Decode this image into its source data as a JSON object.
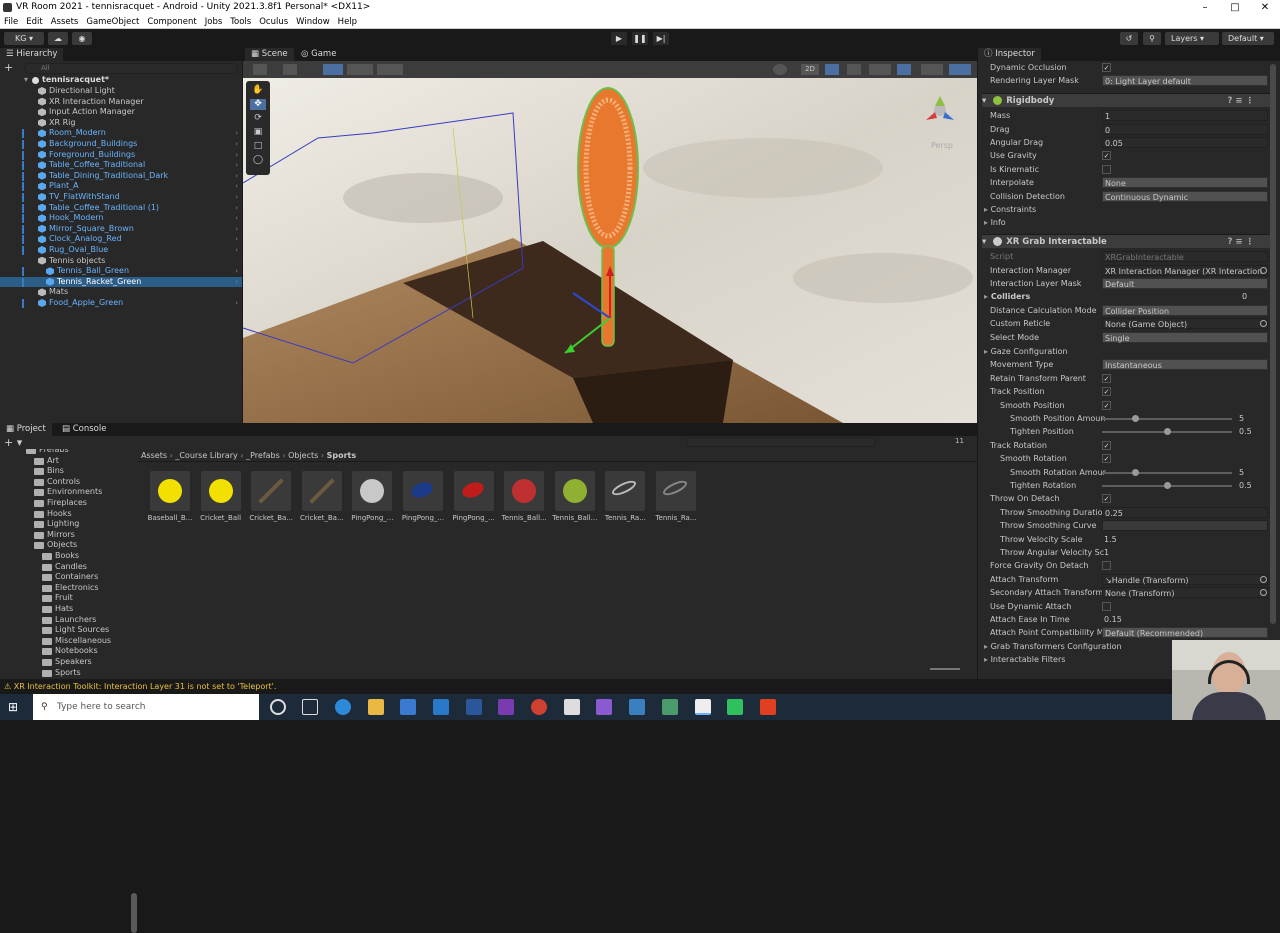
{
  "window": {
    "title": "VR Room 2021 - tennisracquet - Android - Unity 2021.3.8f1 Personal* <DX11>"
  },
  "menu": [
    "File",
    "Edit",
    "Assets",
    "GameObject",
    "Component",
    "Jobs",
    "Tools",
    "Oculus",
    "Window",
    "Help"
  ],
  "toolbar": {
    "account": "KG ▾",
    "layers": "Layers",
    "layout": "Default"
  },
  "hierarchy": {
    "tab": "Hierarchy",
    "search_placeholder": "All",
    "scene": "tennisracquet*",
    "items": [
      {
        "label": "Directional Light",
        "indent": 1,
        "prefab": false
      },
      {
        "label": "XR Interaction Manager",
        "indent": 1,
        "prefab": false
      },
      {
        "label": "Input Action Manager",
        "indent": 1,
        "prefab": false
      },
      {
        "label": "XR Rig",
        "indent": 1,
        "prefab": false
      },
      {
        "label": "Room_Modern",
        "indent": 1,
        "prefab": true
      },
      {
        "label": "Background_Buildings",
        "indent": 1,
        "prefab": true
      },
      {
        "label": "Foreground_Buildings",
        "indent": 1,
        "prefab": true
      },
      {
        "label": "Table_Coffee_Traditional",
        "indent": 1,
        "prefab": true
      },
      {
        "label": "Table_Dining_Traditional_Dark",
        "indent": 1,
        "prefab": true
      },
      {
        "label": "Plant_A",
        "indent": 1,
        "prefab": true
      },
      {
        "label": "TV_FlatWithStand",
        "indent": 1,
        "prefab": true
      },
      {
        "label": "Table_Coffee_Traditional (1)",
        "indent": 1,
        "prefab": true
      },
      {
        "label": "Hook_Modern",
        "indent": 1,
        "prefab": true
      },
      {
        "label": "Mirror_Square_Brown",
        "indent": 1,
        "prefab": true
      },
      {
        "label": "Clock_Analog_Red",
        "indent": 1,
        "prefab": true
      },
      {
        "label": "Rug_Oval_Blue",
        "indent": 1,
        "prefab": true
      },
      {
        "label": "Tennis objects",
        "indent": 1,
        "prefab": false
      },
      {
        "label": "Tennis_Ball_Green",
        "indent": 2,
        "prefab": true
      },
      {
        "label": "Tennis_Racket_Green",
        "indent": 2,
        "prefab": true,
        "selected": true
      },
      {
        "label": "Mats",
        "indent": 1,
        "prefab": false
      },
      {
        "label": "Food_Apple_Green",
        "indent": 1,
        "prefab": true
      }
    ]
  },
  "scene": {
    "tab_scene": "Scene",
    "tab_game": "Game",
    "mode2d": "2D",
    "persp": "Persp"
  },
  "project": {
    "tab_project": "Project",
    "tab_console": "Console",
    "breadcrumb": [
      "Assets",
      "_Course Library",
      "_Prefabs",
      "Objects",
      "Sports"
    ],
    "folders": [
      {
        "label": "Prefabs",
        "indent": 1
      },
      {
        "label": "Art",
        "indent": 2
      },
      {
        "label": "Bins",
        "indent": 2
      },
      {
        "label": "Controls",
        "indent": 2
      },
      {
        "label": "Environments",
        "indent": 2
      },
      {
        "label": "Fireplaces",
        "indent": 2
      },
      {
        "label": "Hooks",
        "indent": 2
      },
      {
        "label": "Lighting",
        "indent": 2
      },
      {
        "label": "Mirrors",
        "indent": 2
      },
      {
        "label": "Objects",
        "indent": 2
      },
      {
        "label": "Books",
        "indent": 3
      },
      {
        "label": "Candles",
        "indent": 3
      },
      {
        "label": "Containers",
        "indent": 3
      },
      {
        "label": "Electronics",
        "indent": 3
      },
      {
        "label": "Fruit",
        "indent": 3
      },
      {
        "label": "Hats",
        "indent": 3
      },
      {
        "label": "Launchers",
        "indent": 3
      },
      {
        "label": "Light Sources",
        "indent": 3
      },
      {
        "label": "Miscellaneous",
        "indent": 3
      },
      {
        "label": "Notebooks",
        "indent": 3
      },
      {
        "label": "Speakers",
        "indent": 3
      },
      {
        "label": "Sports",
        "indent": 3
      }
    ],
    "assets": [
      {
        "label": "Baseball_B...",
        "color": "#f2e000",
        "kind": "ball"
      },
      {
        "label": "Cricket_Ball",
        "color": "#f2e000",
        "kind": "ball"
      },
      {
        "label": "Cricket_Ba...",
        "color": "#6b5a40",
        "kind": "bat"
      },
      {
        "label": "Cricket_Ba...",
        "color": "#6b5a40",
        "kind": "bat"
      },
      {
        "label": "PingPong_...",
        "color": "#c8c8c8",
        "kind": "ball"
      },
      {
        "label": "PingPong_...",
        "color": "#1c3a8a",
        "kind": "paddle"
      },
      {
        "label": "PingPong_...",
        "color": "#c01c1c",
        "kind": "paddle"
      },
      {
        "label": "Tennis_Ball...",
        "color": "#c03030",
        "kind": "ball"
      },
      {
        "label": "Tennis_Ball...",
        "color": "#8fb030",
        "kind": "ball"
      },
      {
        "label": "Tennis_Ra...",
        "color": "#bbbbbb",
        "kind": "racket"
      },
      {
        "label": "Tennis_Ra...",
        "color": "#888888",
        "kind": "racket"
      }
    ],
    "count": "11"
  },
  "inspector": {
    "tab": "Inspector",
    "top_rows": [
      {
        "label": "Dynamic Occlusion",
        "type": "check",
        "value": "✓"
      },
      {
        "label": "Rendering Layer Mask",
        "type": "dropdown",
        "value": "0: Light Layer default"
      }
    ],
    "rigidbody": {
      "title": "Rigidbody",
      "rows": [
        {
          "label": "Mass",
          "type": "field",
          "value": "1"
        },
        {
          "label": "Drag",
          "type": "field",
          "value": "0"
        },
        {
          "label": "Angular Drag",
          "type": "field",
          "value": "0.05"
        },
        {
          "label": "Use Gravity",
          "type": "check",
          "value": "✓"
        },
        {
          "label": "Is Kinematic",
          "type": "check",
          "value": ""
        },
        {
          "label": "Interpolate",
          "type": "dropdown",
          "value": "None"
        },
        {
          "label": "Collision Detection",
          "type": "dropdown",
          "value": "Continuous Dynamic"
        },
        {
          "label": "Constraints",
          "type": "fold",
          "value": ""
        },
        {
          "label": "Info",
          "type": "fold",
          "value": ""
        }
      ]
    },
    "grab": {
      "title": "XR Grab Interactable",
      "rows": [
        {
          "label": "Script",
          "type": "script",
          "value": "XRGrabInteractable"
        },
        {
          "label": "Interaction Manager",
          "type": "object",
          "value": "XR Interaction Manager (XR Interaction"
        },
        {
          "label": "Interaction Layer Mask",
          "type": "dropdown",
          "value": "Default"
        },
        {
          "label": "Colliders",
          "type": "foldbold",
          "value": "0"
        },
        {
          "label": "Distance Calculation Mode",
          "type": "dropdown",
          "value": "Collider Position"
        },
        {
          "label": "Custom Reticle",
          "type": "object",
          "value": "None (Game Object)"
        },
        {
          "label": "Select Mode",
          "type": "dropdown",
          "value": "Single"
        },
        {
          "label": "Gaze Configuration",
          "type": "fold",
          "value": ""
        },
        {
          "label": "Movement Type",
          "type": "dropdown",
          "value": "Instantaneous"
        },
        {
          "label": "Retain Transform Parent",
          "type": "check",
          "value": "✓"
        },
        {
          "label": "Track Position",
          "type": "check",
          "value": "✓"
        },
        {
          "label": "Smooth Position",
          "type": "check",
          "value": "✓",
          "indent": 1
        },
        {
          "label": "Smooth Position Amoun",
          "type": "slider",
          "value": "5",
          "fraction": 0.25,
          "indent": 2
        },
        {
          "label": "Tighten Position",
          "type": "slider",
          "value": "0.5",
          "fraction": 0.5,
          "indent": 2
        },
        {
          "label": "Track Rotation",
          "type": "check",
          "value": "✓"
        },
        {
          "label": "Smooth Rotation",
          "type": "check",
          "value": "✓",
          "indent": 1
        },
        {
          "label": "Smooth Rotation Amour",
          "type": "slider",
          "value": "5",
          "fraction": 0.25,
          "indent": 2
        },
        {
          "label": "Tighten Rotation",
          "type": "slider",
          "value": "0.5",
          "fraction": 0.5,
          "indent": 2
        },
        {
          "label": "Throw On Detach",
          "type": "check",
          "value": "✓"
        },
        {
          "label": "Throw Smoothing Duration",
          "type": "field",
          "value": "0.25",
          "indent": 1
        },
        {
          "label": "Throw Smoothing Curve",
          "type": "curve",
          "value": "",
          "indent": 1
        },
        {
          "label": "Throw Velocity Scale",
          "type": "plain",
          "value": "1.5",
          "indent": 1
        },
        {
          "label": "Throw Angular Velocity Sc",
          "type": "plain",
          "value": "1",
          "indent": 1
        },
        {
          "label": "Force Gravity On Detach",
          "type": "check",
          "value": ""
        },
        {
          "label": "Attach Transform",
          "type": "object",
          "value": "↘Handle (Transform)"
        },
        {
          "label": "Secondary Attach Transform",
          "type": "object",
          "value": "None (Transform)"
        },
        {
          "label": "Use Dynamic Attach",
          "type": "check",
          "value": ""
        },
        {
          "label": "Attach Ease In Time",
          "type": "plain",
          "value": "0.15"
        },
        {
          "label": "Attach Point Compatibility Mc",
          "type": "dropdown",
          "value": "Default (Recommended)"
        },
        {
          "label": "Grab Transformers Configuration",
          "type": "fold",
          "value": ""
        },
        {
          "label": "Interactable Filters",
          "type": "fold",
          "value": ""
        }
      ]
    }
  },
  "status": {
    "warning": "XR Interaction Toolkit: Interaction Layer 31 is not set to 'Teleport'."
  },
  "taskbar": {
    "search_placeholder": "Type here to search"
  },
  "colors": {
    "accent": "#2c5d87",
    "prefab": "#6ab4ff",
    "racket": "#e8782e"
  }
}
